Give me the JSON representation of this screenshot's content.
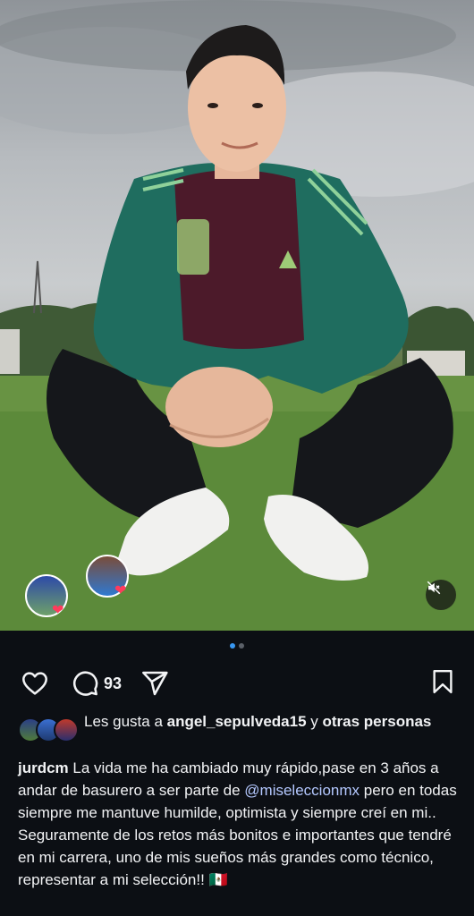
{
  "post": {
    "media_alt": "Photo of a man crouching on a grass field wearing a green and maroon track jacket",
    "carousel": {
      "count": 2,
      "active": 1
    },
    "muted": true
  },
  "actions": {
    "like_icon": "heart-icon",
    "comment_icon": "comment-icon",
    "comment_count": "93",
    "share_icon": "send-icon",
    "save_icon": "bookmark-icon"
  },
  "likes": {
    "prefix": "Les gusta a ",
    "user": "angel_sepulveda15",
    "mid": " y ",
    "others": "otras personas"
  },
  "caption": {
    "username": "jurdcm",
    "text_1": " La vida me ha cambiado muy rápido,pase en 3 años a andar de basurero a ser parte de ",
    "mention": "@miseleccionmx",
    "text_2": " pero en todas siempre me mantuve humilde, optimista y siempre creí en mi.. Seguramente de los retos más bonitos e importantes que tendré en mi carrera, uno de mis sueños más grandes como técnico, representar a mi selección!! 🇲🇽"
  },
  "colors": {
    "background": "#0c0f14",
    "text": "#f2f3f5",
    "mention": "#b4c8ff",
    "dot_active": "#3897f0",
    "heart": "#ff3b5c"
  }
}
